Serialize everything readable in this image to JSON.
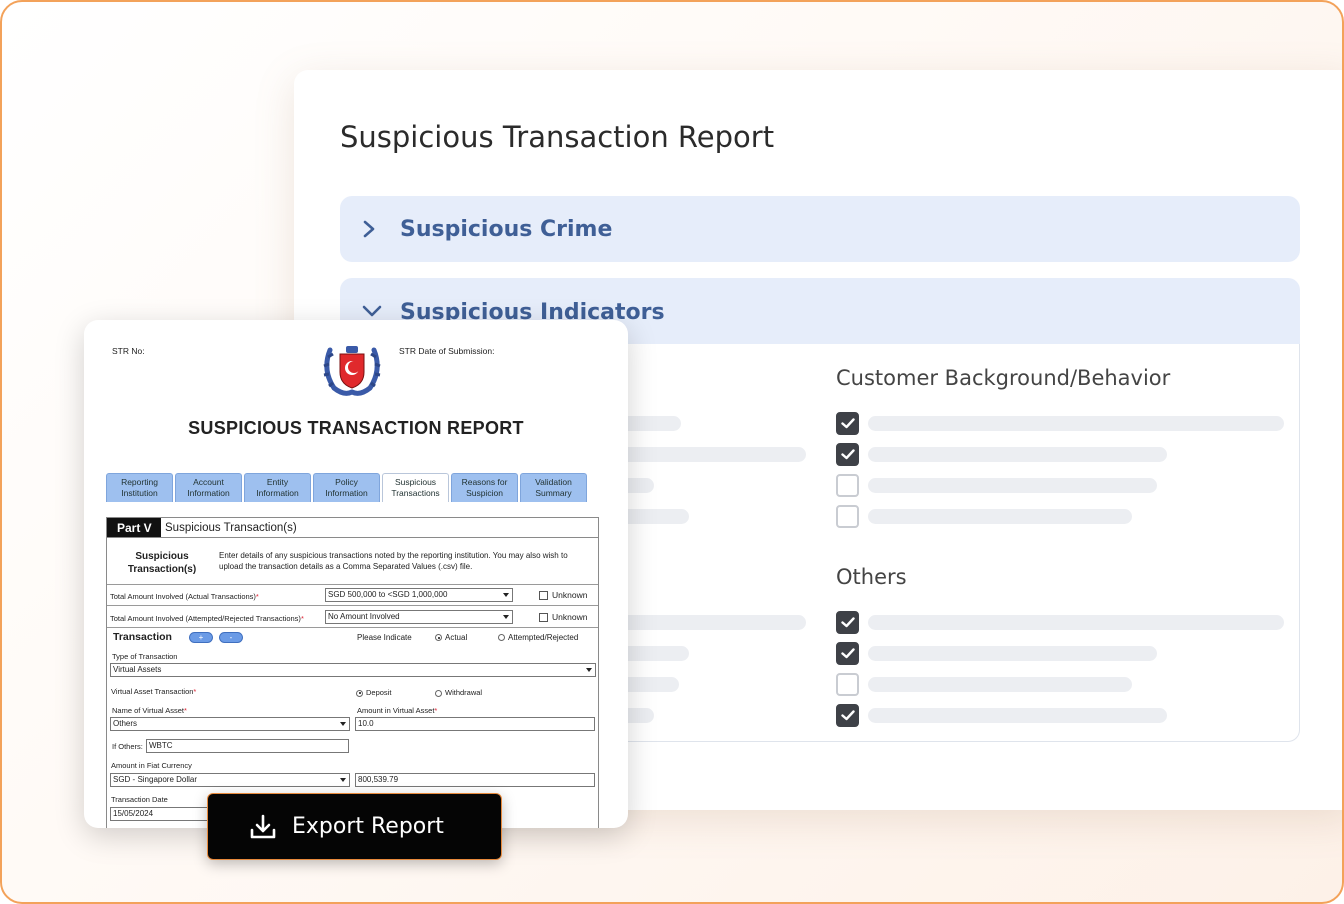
{
  "panel": {
    "title": "Suspicious Transaction Report",
    "accordion": [
      {
        "label": "Suspicious Crime",
        "expanded": false
      },
      {
        "label": "Suspicious Indicators",
        "expanded": true
      }
    ],
    "groups": {
      "customer": {
        "title": "Customer Background/Behavior",
        "checks": [
          true,
          true,
          false,
          false
        ]
      },
      "others": {
        "title": "Others",
        "checks": [
          true,
          true,
          false,
          true
        ]
      }
    }
  },
  "form": {
    "str_no_label": "STR No:",
    "str_date_label": "STR Date of Submission:",
    "title": "SUSPICIOUS TRANSACTION REPORT",
    "tabs": [
      {
        "line1": "Reporting",
        "line2": "Institution"
      },
      {
        "line1": "Account",
        "line2": "Information"
      },
      {
        "line1": "Entity",
        "line2": "Information"
      },
      {
        "line1": "Policy",
        "line2": "Information"
      },
      {
        "line1": "Suspicious",
        "line2": "Transactions"
      },
      {
        "line1": "Reasons for",
        "line2": "Suspicion"
      },
      {
        "line1": "Validation",
        "line2": "Summary"
      }
    ],
    "part_label": "Part V",
    "part_name": "Suspicious Transaction(s)",
    "section_heading_1": "Suspicious",
    "section_heading_2": "Transaction(s)",
    "section_desc": "Enter details of any suspicious transactions noted by the reporting institution. You may also wish to upload the transaction details as a Comma Separated Values (.csv) file.",
    "total_actual_label": "Total Amount Involved (Actual Transactions)",
    "total_actual_value": "SGD 500,000 to <SGD 1,000,000",
    "total_attempted_label": "Total Amount Involved (Attempted/Rejected Transactions)",
    "total_attempted_value": "No Amount Involved",
    "unknown_label": "Unknown",
    "transaction_label": "Transaction",
    "plus": "+",
    "minus": "-",
    "please_indicate": "Please Indicate",
    "actual": "Actual",
    "attempted": "Attempted/Rejected",
    "type_label": "Type of Transaction",
    "type_value": "Virtual Assets",
    "va_txn_label": "Virtual Asset Transaction",
    "deposit": "Deposit",
    "withdrawal": "Withdrawal",
    "va_name_label": "Name of Virtual Asset",
    "va_name_value": "Others",
    "va_amount_label": "Amount in Virtual Asset",
    "va_amount_value": "10.0",
    "if_others_label": "If Others:",
    "if_others_value": "WBTC",
    "fiat_label": "Amount in Fiat Currency",
    "fiat_currency": "SGD - Singapore Dollar",
    "fiat_amount": "800,539.79",
    "date_label": "Transaction Date",
    "date_value": "15/05/2024"
  },
  "export_button": "Export Report"
}
